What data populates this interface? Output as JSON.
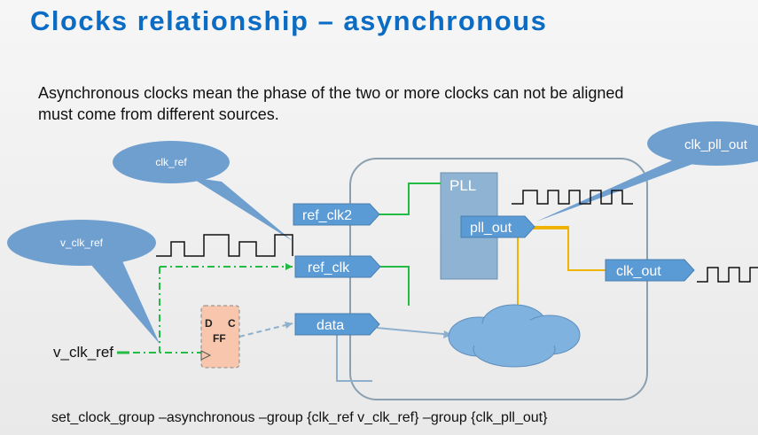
{
  "title": "Clocks relationship – asynchronous",
  "description": {
    "line1": "Asynchronous clocks mean the phase of the two or more clocks can not be aligned",
    "line2": "must come from different sources."
  },
  "callouts": {
    "clk_ref": "clk_ref",
    "v_clk_ref": "v_clk_ref",
    "clk_pll_out": "clk_pll_out"
  },
  "ports": {
    "ref_clk2": "ref_clk2",
    "ref_clk": "ref_clk",
    "data": "data",
    "clk_out": "clk_out"
  },
  "pll": {
    "label": "PLL",
    "out_label": "pll_out"
  },
  "flipflop": {
    "d": "D",
    "c": "C",
    "ff": "FF"
  },
  "input_label": "v_clk_ref",
  "command": "set_clock_group –asynchronous –group {clk_ref v_clk_ref} –group {clk_pll_out}",
  "colors": {
    "title": "#0a6cc4",
    "port_fill": "#5b9bd5",
    "pll_fill": "#8fb4d3",
    "callout_fill": "#6f9fcf",
    "green_wire": "#22bb44",
    "orange_wire": "#f0b400",
    "blue_wire": "#8fb0cc",
    "ff_fill": "#f7c6ad"
  }
}
